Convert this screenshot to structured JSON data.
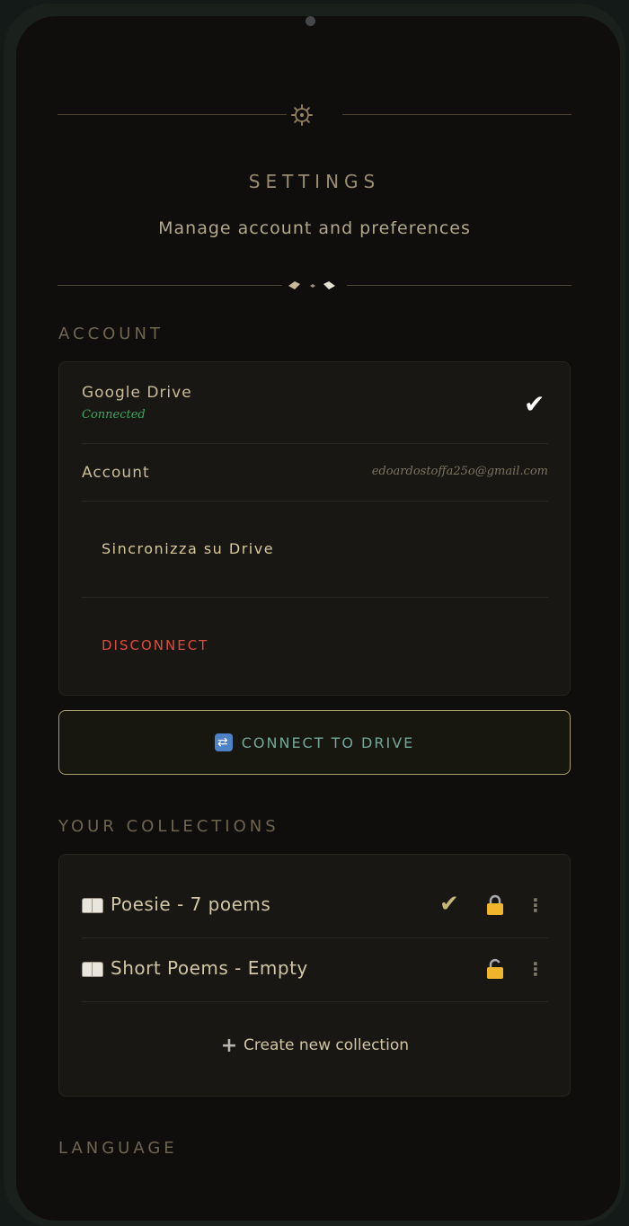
{
  "header": {
    "title": "SETTINGS",
    "subtitle": "Manage account and preferences"
  },
  "account": {
    "section_title": "ACCOUNT",
    "google_drive_label": "Google Drive",
    "status": "Connected",
    "status_icon": "check-icon",
    "account_label": "Account",
    "email": "edoardostoffa25o@gmail.com",
    "sync_label": "Sincronizza su Drive",
    "disconnect_label": "DISCONNECT"
  },
  "connect_button": {
    "icon": "sync-icon",
    "label": "CONNECT TO DRIVE"
  },
  "collections": {
    "section_title": "YOUR COLLECTIONS",
    "items": [
      {
        "name": "Poesie - 7 poems",
        "selected": true,
        "lock": "locked"
      },
      {
        "name": "Short Poems - Empty",
        "selected": false,
        "lock": "unlocked"
      }
    ],
    "create_label": "Create new collection"
  },
  "language": {
    "section_title": "LANGUAGE"
  },
  "colors": {
    "background": "#0f0e0c",
    "gold": "#a89b6e",
    "connected_green": "#3fa55f",
    "danger_red": "#dd4b3c",
    "teal_text": "#72a79a"
  }
}
